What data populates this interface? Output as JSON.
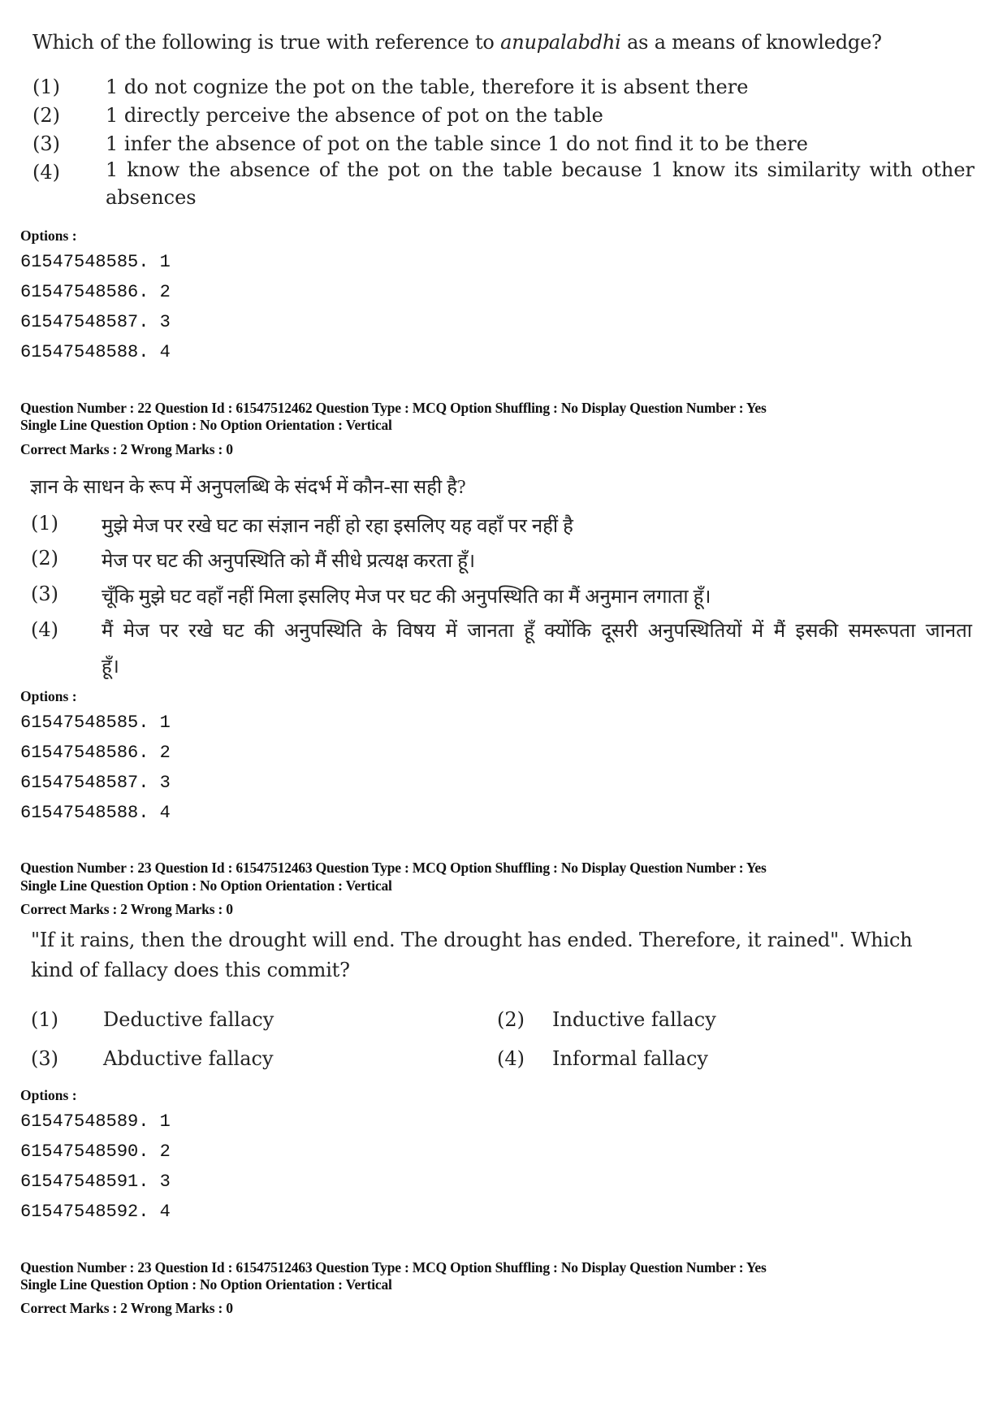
{
  "block1": {
    "question_pre": "Which of the following is true with reference to ",
    "question_italic": "anupalabdhi",
    "question_post": " as a means of knowledge?",
    "choices": [
      {
        "num": "(1)",
        "text": "1 do not cognize the pot on the table, therefore it is absent there"
      },
      {
        "num": "(2)",
        "text": "1 directly perceive the absence of pot on the table"
      },
      {
        "num": "(3)",
        "text": "1 infer the absence of pot on the table since 1 do not find it to be there"
      },
      {
        "num": "(4)",
        "text": "1 know the absence of the pot on the table because 1 know its similarity with other absences"
      }
    ],
    "options_label": "Options :",
    "option_ids": [
      "61547548585. 1",
      "61547548586. 2",
      "61547548587. 3",
      "61547548588. 4"
    ]
  },
  "block2": {
    "meta_line1": "Question Number : 22  Question Id : 61547512462  Question Type : MCQ  Option Shuffling : No  Display Question Number : Yes",
    "meta_line2": "Single Line Question Option : No  Option Orientation : Vertical",
    "marks": "Correct Marks : 2  Wrong Marks : 0",
    "question": "ज्ञान के साधन के रूप में अनुपलब्धि के संदर्भ में कौन-सा सही है?",
    "choices": [
      {
        "num": "(1)",
        "text": "मुझे मेज पर रखे घट का संज्ञान नहीं हो रहा इसलिए यह वहाँ पर नहीं है"
      },
      {
        "num": "(2)",
        "text": "मेज पर घट की अनुपस्थिति को मैं सीधे प्रत्यक्ष करता हूँ।"
      },
      {
        "num": "(3)",
        "text": "चूँकि मुझे घट वहाँ नहीं मिला इसलिए मेज पर घट की अनुपस्थिति का मैं अनुमान लगाता हूँ।"
      },
      {
        "num": "(4)",
        "text": "मैं मेज पर रखे घट की अनुपस्थिति के विषय में जानता हूँ क्योंकि दूसरी अनुपस्थितियों में मैं इसकी समरूपता जानता हूँ।"
      }
    ],
    "options_label": "Options :",
    "option_ids": [
      "61547548585. 1",
      "61547548586. 2",
      "61547548587. 3",
      "61547548588. 4"
    ]
  },
  "block3": {
    "meta_line1": "Question Number : 23  Question Id : 61547512463  Question Type : MCQ  Option Shuffling : No  Display Question Number : Yes",
    "meta_line2": "Single Line Question Option : No  Option Orientation : Vertical",
    "marks": "Correct Marks : 2  Wrong Marks : 0",
    "question_line1": "\"If it rains, then the drought will end. The drought has ended. Therefore, it rained\". Which",
    "question_line2": "kind of fallacy does this commit?",
    "choices": [
      {
        "num": "(1)",
        "text": "Deductive fallacy"
      },
      {
        "num": "(2)",
        "text": "Inductive fallacy"
      },
      {
        "num": "(3)",
        "text": "Abductive fallacy"
      },
      {
        "num": "(4)",
        "text": "Informal fallacy"
      }
    ],
    "options_label": "Options :",
    "option_ids": [
      "61547548589. 1",
      "61547548590. 2",
      "61547548591. 3",
      "61547548592. 4"
    ]
  },
  "block4": {
    "meta_line1": "Question Number : 23  Question Id : 61547512463  Question Type : MCQ  Option Shuffling : No  Display Question Number : Yes",
    "meta_line2": "Single Line Question Option : No  Option Orientation : Vertical",
    "marks": "Correct Marks : 2  Wrong Marks : 0"
  }
}
